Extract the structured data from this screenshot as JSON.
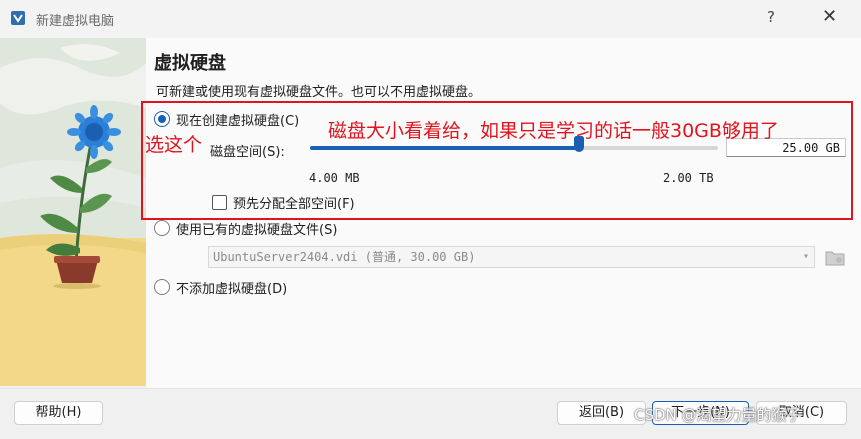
{
  "window": {
    "title": "新建虚拟电脑",
    "help_glyph": "?",
    "close_glyph": "✕"
  },
  "page": {
    "title": "虚拟硬盘",
    "subtitle": "可新建或使用现有虚拟硬盘文件。也可以不用虚拟硬盘。"
  },
  "options": {
    "create_new": {
      "label": "现在创建虚拟硬盘(C)",
      "selected": true
    },
    "use_existing": {
      "label": "使用已有的虚拟硬盘文件(S)",
      "selected": false
    },
    "no_disk": {
      "label": "不添加虚拟硬盘(D)",
      "selected": false
    }
  },
  "disk": {
    "size_label": "磁盘空间(S):",
    "size_value": "25.00 GB",
    "min_label": "4.00 MB",
    "max_label": "2.00 TB",
    "slider_fraction": 0.66,
    "preallocate_label": "预先分配全部空间(F)",
    "preallocate_checked": false
  },
  "existing_file": {
    "value": "UbuntuServer2404.vdi (普通, 30.00 GB)"
  },
  "annotations": {
    "pick": "选这个",
    "note": "磁盘大小看着给，如果只是学习的话一般30GB够用了"
  },
  "buttons": {
    "help": "帮助(H)",
    "back": "返回(B)",
    "next": "下一步(N)",
    "cancel": "取消(C)"
  },
  "watermark": "CSDN @渴望力量的猴子",
  "colors": {
    "accent": "#1a5fb4",
    "annotation": "#e0141e"
  }
}
